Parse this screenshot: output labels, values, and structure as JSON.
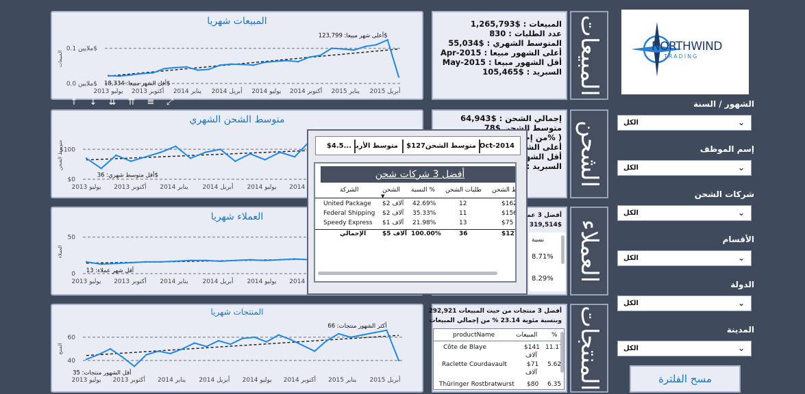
{
  "logo": {
    "text": "NORTHWIND",
    "sub": "TRADING"
  },
  "filters": [
    {
      "label": "الشهور / السنة",
      "value": "الكل"
    },
    {
      "label": "إسم الموظف",
      "value": "الكل"
    },
    {
      "label": "شركات الشحن",
      "value": "الكل"
    },
    {
      "label": "الأقسام",
      "value": "الكل"
    },
    {
      "label": "الدولة",
      "value": "الكل"
    },
    {
      "label": "المدينة",
      "value": "الكل"
    }
  ],
  "clear_filter": "مسح الفلترة",
  "sections": {
    "sales": "المبيعات",
    "shipping": "الشحن",
    "customers": "العملاء",
    "products": "المنتجات"
  },
  "kpi_sales": [
    {
      "label": "المبيعات :",
      "value": "$1,265,793"
    },
    {
      "label": "عدد الطلبات :",
      "value": "830"
    },
    {
      "label": "المتوسط الشهري :",
      "value": "$55,034"
    },
    {
      "label": "أعلى الشهور مبيعا :",
      "value": "Apr-2015"
    },
    {
      "label": "أقل الشهور مبيعا :",
      "value": "May-2015"
    },
    {
      "label": "السبريد :",
      "value": "$105,465"
    }
  ],
  "kpi_shipping": [
    {
      "label": "إجمالي الشحن :",
      "value": "$64,943"
    },
    {
      "label": "متوسط الشحن",
      "value": "$78"
    },
    {
      "label": "( %من إجمالي",
      "value": ""
    },
    {
      "label": "أعلى الشهو",
      "value": ""
    },
    {
      "label": "أقل الشهو",
      "value": ""
    },
    {
      "label": "السبريد :",
      "value": ""
    }
  ],
  "kpi_customers": {
    "line1": "أفضل 3 عملاء",
    "line2": "319,514$",
    "col_pct": "نسبة",
    "rows": [
      "8.71%",
      "8.29%"
    ]
  },
  "kpi_products": {
    "line1": "أفضل 3 منتجات من حيث المبيعات 292,921",
    "line2": "وبنسبة مئوية 23.14 %  من  إجمالي المبيعات",
    "headers": {
      "name": "productName",
      "sales": "المبيعات",
      "pct": "%"
    },
    "rows": [
      {
        "name": "Côte de Blaye",
        "sales": "$141",
        "unit": "آلاف",
        "pct": "11.17"
      },
      {
        "name": "Raclette Courdavault",
        "sales": "$71",
        "unit": "آلاف",
        "pct": "5.62"
      },
      {
        "name": "Thüringer Rostbratwurst",
        "sales": "$80",
        "unit": "",
        "pct": "6.35"
      }
    ]
  },
  "charts": {
    "sales": {
      "title": "المبيعات شهريا",
      "ylabel": "المبيعات",
      "y_ticks": [
        "ملايين 0.1$",
        "ملايين 0.0$"
      ],
      "x_ticks": [
        "يوليو 2013",
        "أكتوبر 2013",
        "يناير 2014",
        "أبريل 2014",
        "يوليو 2014",
        "أكتوبر 2014",
        "يناير 2015",
        "أبريل 2015"
      ],
      "annot_high": "أعلى شهر مبيعا: 123,799$",
      "annot_low": "أقل الشهر مبيعا: 18,334$"
    },
    "shipping": {
      "title": "متوسط الشحن الشهري",
      "ylabel": "متوسط الشحن",
      "y_ticks": [
        "$100",
        "$0"
      ],
      "x_ticks": [
        "يوليو 2013",
        "أكتوبر 2013",
        "يناير 2014",
        "أبريل 2014",
        "يوليو 2014",
        "أكتوبر 2014"
      ],
      "annot_low": "أقل متوسط شهري: 36$"
    },
    "customers": {
      "title": "العملاء شهريا",
      "ylabel": "العملاء",
      "y_ticks": [
        "50",
        "0"
      ],
      "x_ticks": [
        "يوليو 2013",
        "أكتوبر 2013",
        "يناير 2014",
        "أبريل 2014",
        "يوليو 2014",
        "أكتوبر 2014"
      ],
      "annot_low": "أقل شهر عملاء: 13"
    },
    "products": {
      "title": "المنتجات شهريا",
      "ylabel": "المنتج",
      "y_ticks": [
        "60",
        "40"
      ],
      "x_ticks": [
        "يوليو 2013",
        "أكتوبر 2013",
        "يناير 2014",
        "أبريل 2014",
        "يوليو 2014",
        "أكتوبر 2014",
        "يناير 2015",
        "أبريل 2015"
      ],
      "annot_high": "أكثر الشهور منتجات: 66",
      "annot_low": "أقل الشهور منتجات: 35"
    }
  },
  "tooltip": {
    "date": "Oct-2014",
    "avg_ship_label": "متوسط الشحن",
    "avg_ship_value": "$127",
    "avg3_label": "متوسط الأربا",
    "avg3_value": "$4.5...",
    "table_title": "أفضل 3 شركات شحن",
    "headers": {
      "company": "الشركة",
      "ship": "الشحن",
      "pct": "النسبة %",
      "orders": "طلبات الشحن",
      "total": "ط الشحن"
    },
    "rows": [
      {
        "company": "United Package",
        "ship": "$2 آلاف",
        "pct": "42.69%",
        "orders": "12",
        "total": "$162"
      },
      {
        "company": "Federal Shipping",
        "ship": "$2 آلاف",
        "pct": "35.33%",
        "orders": "11",
        "total": "$156"
      },
      {
        "company": "Speedy Express",
        "ship": "$1 آلاف",
        "pct": "21.98%",
        "orders": "13",
        "total": "$75"
      }
    ],
    "total": {
      "company": "الإجمالي",
      "ship": "$5 آلاف",
      "pct": "100.00%",
      "orders": "36",
      "total": "$127"
    }
  },
  "toolbar_icons": [
    "arrow-up-icon",
    "arrow-down-icon",
    "double-arrow-down-icon",
    "hierarchy-icon",
    "filter-icon",
    "focus-mode-icon"
  ],
  "chart_data": [
    {
      "type": "line",
      "title": "المبيعات شهريا",
      "ylabel": "المبيعات",
      "y_unit": "$",
      "ylim": [
        0,
        140000
      ],
      "series": [
        {
          "values": [
            22000,
            21000,
            24000,
            28000,
            30000,
            42000,
            45000,
            47000,
            38000,
            40000,
            52000,
            55000,
            54000,
            52000,
            60000,
            63000,
            65000,
            62000,
            75000,
            80000,
            100000,
            98000,
            95000,
            105000,
            110000,
            123799,
            18334
          ]
        }
      ]
    },
    {
      "type": "line",
      "title": "متوسط الشحن الشهري",
      "ylabel": "متوسط الشحن",
      "ylim": [
        0,
        160
      ],
      "series": [
        {
          "values": [
            70,
            36,
            80,
            60,
            75,
            90,
            110,
            70,
            90,
            100,
            60,
            85,
            65,
            90,
            75,
            127
          ]
        }
      ]
    },
    {
      "type": "line",
      "title": "العملاء شهريا",
      "ylabel": "العملاء",
      "ylim": [
        0,
        60
      ],
      "series": [
        {
          "values": [
            16,
            13,
            14,
            15,
            16,
            16,
            17,
            18,
            18,
            17,
            18,
            19,
            18,
            19,
            20,
            19
          ]
        }
      ]
    },
    {
      "type": "line",
      "title": "المنتجات شهريا",
      "ylabel": "المنتج",
      "ylim": [
        30,
        70
      ],
      "series": [
        {
          "values": [
            41,
            45,
            50,
            43,
            35,
            45,
            48,
            46,
            50,
            55,
            52,
            57,
            54,
            59,
            60,
            56,
            62,
            58,
            53,
            48,
            57,
            63,
            60,
            62,
            64,
            66,
            40
          ]
        }
      ]
    }
  ]
}
